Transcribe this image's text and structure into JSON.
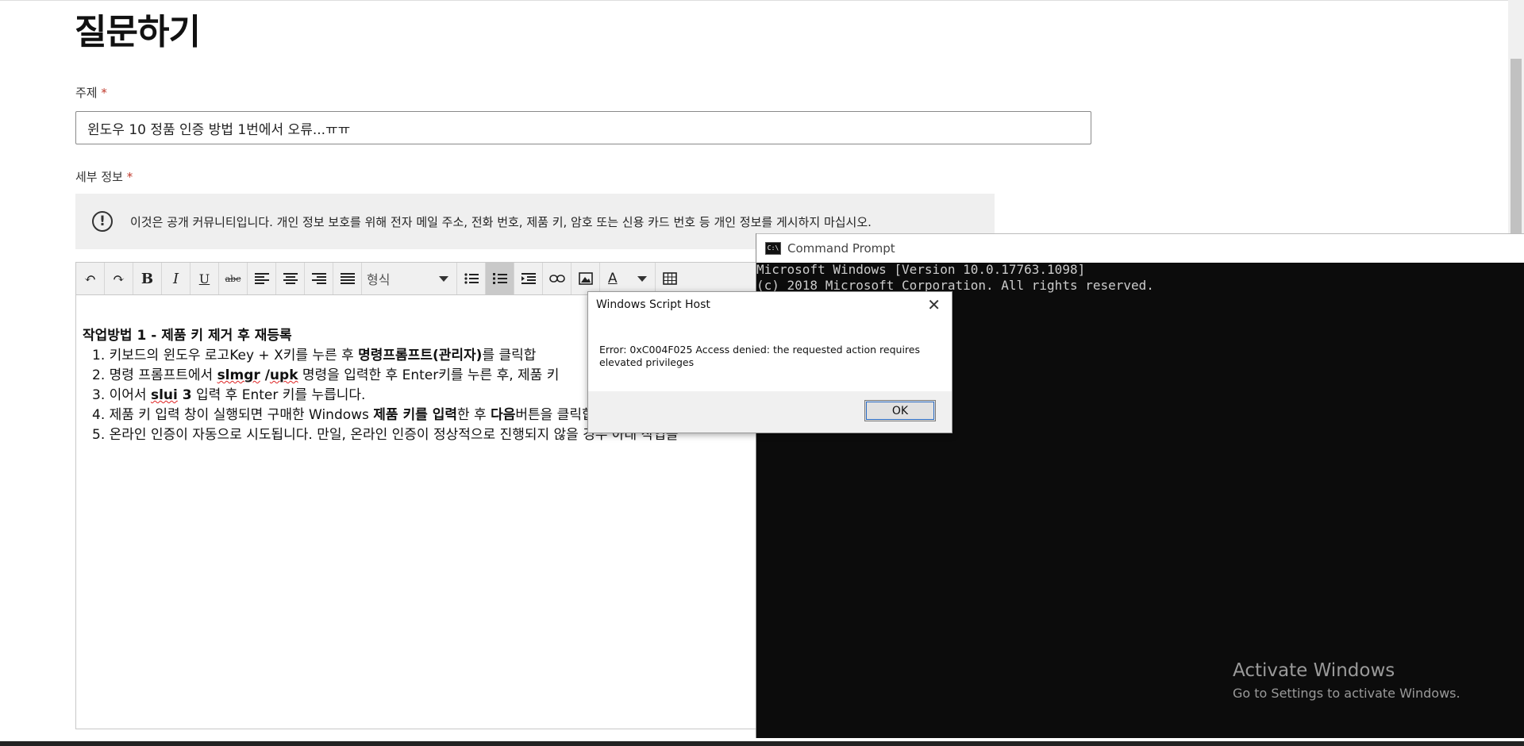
{
  "page": {
    "title": "질문하기",
    "subject_label": "주제",
    "required_mark": "*",
    "subject_value": "윈도우 10 정품 인증 방법 1번에서 오류...ㅠㅠ",
    "details_label": "세부 정보",
    "notice_icon": "!",
    "notice": "이것은 공개 커뮤니티입니다. 개인 정보 보호를 위해 전자 메일 주소, 전화 번호, 제품 키, 암호 또는 신용 카드 번호 등 개인 정보를 게시하지 마십시오."
  },
  "toolbar": {
    "undo": "↶",
    "redo": "↷",
    "bold": "B",
    "italic": "I",
    "underline": "U",
    "strike": "abc",
    "format_label": "형식",
    "text_color": "A",
    "icons": [
      "undo-icon",
      "redo-icon",
      "bold-icon",
      "italic-icon",
      "underline-icon",
      "strikethrough-icon",
      "align-left-icon",
      "align-center-icon",
      "align-right-icon",
      "justify-icon",
      "bullet-list-icon",
      "numbered-list-icon",
      "indent-icon",
      "link-icon",
      "image-icon",
      "text-color-icon",
      "table-icon"
    ]
  },
  "editor": {
    "heading": "작업방법 1 - 제품 키 제거 후 재등록",
    "step1_a": "1. 키보드의 윈도우 로고Key + X키를 누른 후 ",
    "step1_b": "명령프롬프트(관리자)",
    "step1_c": "를 클릭합",
    "step2_a": "2. 명령 프롬프트에서 ",
    "step2_b": "slmgr",
    "step2_c": " /",
    "step2_d": "upk",
    "step2_e": " 명령을 입력한 후 Enter키를 누른 후, 제품 키",
    "step3_a": "3. 이어서 ",
    "step3_b": "slui",
    "step3_c": " 3",
    "step3_d": " 입력 후 Enter 키를 누릅니다.",
    "step4_a": "4. 제품 키 입력 창이 실행되면 구매한 Windows ",
    "step4_b": "제품 키를 입력",
    "step4_c": "한 후 ",
    "step4_d": "다음",
    "step4_e": "버튼을 클릭합니다.",
    "step5": "5. 온라인 인증이 자동으로 시도됩니다. 만일, 온라인 인증이 정상적으로 진행되지 않을 경우 아래 작업을"
  },
  "cmd": {
    "title": "Command Prompt",
    "icon_text": "C:\\",
    "line1": "Microsoft Windows [Version 10.0.17763.1098]",
    "line2": "(c) 2018 Microsoft Corporation. All rights reserved."
  },
  "dialog": {
    "title": "Windows Script Host",
    "close": "✕",
    "message": "Error: 0xC004F025 Access denied: the requested action requires elevated privileges",
    "ok": "OK"
  },
  "watermark": {
    "title": "Activate Windows",
    "subtitle": "Go to Settings to activate Windows."
  }
}
